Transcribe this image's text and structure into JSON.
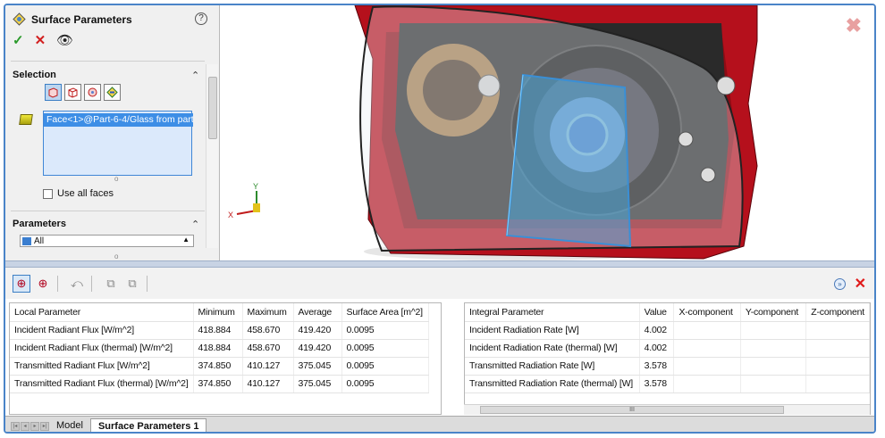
{
  "property_manager": {
    "title": "Surface Parameters",
    "selection_heading": "Selection",
    "selected_face": "Face<1>@Part-6-4/Glass from part",
    "use_all_faces": "Use all faces",
    "parameters_heading": "Parameters",
    "parameters_value": "All"
  },
  "local_table": {
    "headers": [
      "Local Parameter",
      "Minimum",
      "Maximum",
      "Average",
      "Surface Area [m^2]"
    ],
    "rows": [
      [
        "Incident Radiant Flux [W/m^2]",
        "418.884",
        "458.670",
        "419.420",
        "0.0095"
      ],
      [
        "Incident Radiant Flux (thermal) [W/m^2]",
        "418.884",
        "458.670",
        "419.420",
        "0.0095"
      ],
      [
        "Transmitted Radiant Flux [W/m^2]",
        "374.850",
        "410.127",
        "375.045",
        "0.0095"
      ],
      [
        "Transmitted Radiant Flux (thermal) [W/m^2]",
        "374.850",
        "410.127",
        "375.045",
        "0.0095"
      ]
    ]
  },
  "integral_table": {
    "headers": [
      "Integral Parameter",
      "Value",
      "X-component",
      "Y-component",
      "Z-component"
    ],
    "rows": [
      [
        "Incident Radiation Rate [W]",
        "4.002",
        "",
        "",
        ""
      ],
      [
        "Incident Radiation Rate (thermal) [W]",
        "4.002",
        "",
        "",
        ""
      ],
      [
        "Transmitted Radiation Rate [W]",
        "3.578",
        "",
        "",
        ""
      ],
      [
        "Transmitted Radiation Rate (thermal) [W]",
        "3.578",
        "",
        "",
        ""
      ]
    ]
  },
  "tabs": [
    "Model",
    "Surface Parameters 1"
  ],
  "colors": {
    "accent": "#3d8ee6",
    "frame": "#4a84c8",
    "headlight_red": "#b5101c"
  }
}
